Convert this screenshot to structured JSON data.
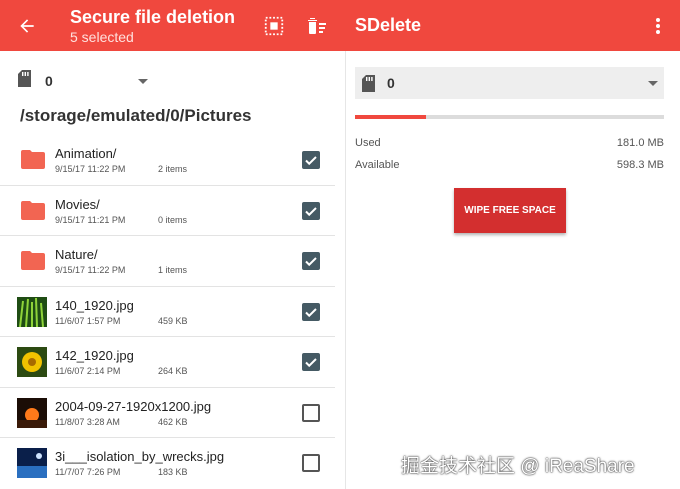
{
  "left_toolbar": {
    "title": "Secure file deletion",
    "subtitle": "5 selected",
    "icons": [
      "back-arrow-icon",
      "select-all-icon",
      "delete-sweep-icon"
    ]
  },
  "right_toolbar": {
    "title": "SDelete",
    "icons": [
      "overflow-menu-icon"
    ]
  },
  "left_volume": {
    "value": "0",
    "icon": "sd-card-icon"
  },
  "path": "/storage/emulated/0/Pictures",
  "files": [
    {
      "name": "Animation/",
      "date": "9/15/17 11:22 PM",
      "meta": "2 items",
      "type": "folder",
      "checked": true
    },
    {
      "name": "Movies/",
      "date": "9/15/17 11:21 PM",
      "meta": "0 items",
      "type": "folder",
      "checked": true
    },
    {
      "name": "Nature/",
      "date": "9/15/17 11:22 PM",
      "meta": "1 items",
      "type": "folder",
      "checked": true
    },
    {
      "name": "140_1920.jpg",
      "date": "11/6/07 1:57 PM",
      "meta": "459 KB",
      "type": "image",
      "checked": true
    },
    {
      "name": "142_1920.jpg",
      "date": "11/6/07 2:14 PM",
      "meta": "264 KB",
      "type": "image",
      "checked": true
    },
    {
      "name": "2004-09-27-1920x1200.jpg",
      "date": "11/8/07 3:28 AM",
      "meta": "462 KB",
      "type": "image",
      "checked": false
    },
    {
      "name": "3i___isolation_by_wrecks.jpg",
      "date": "11/7/07 7:26 PM",
      "meta": "183 KB",
      "type": "image",
      "checked": false
    }
  ],
  "right_volume": {
    "value": "0",
    "icon": "sd-card-icon"
  },
  "storage": {
    "used_fraction": 0.23,
    "used_label": "Used",
    "used_value": "181.0 MB",
    "available_label": "Available",
    "available_value": "598.3 MB"
  },
  "wipe_button": "WIPE FREE SPACE",
  "watermark": "掘金技术社区 @ iReaShare",
  "colors": {
    "accent": "#f0483e",
    "button": "#d32f2f",
    "checkbox": "#455a64"
  }
}
